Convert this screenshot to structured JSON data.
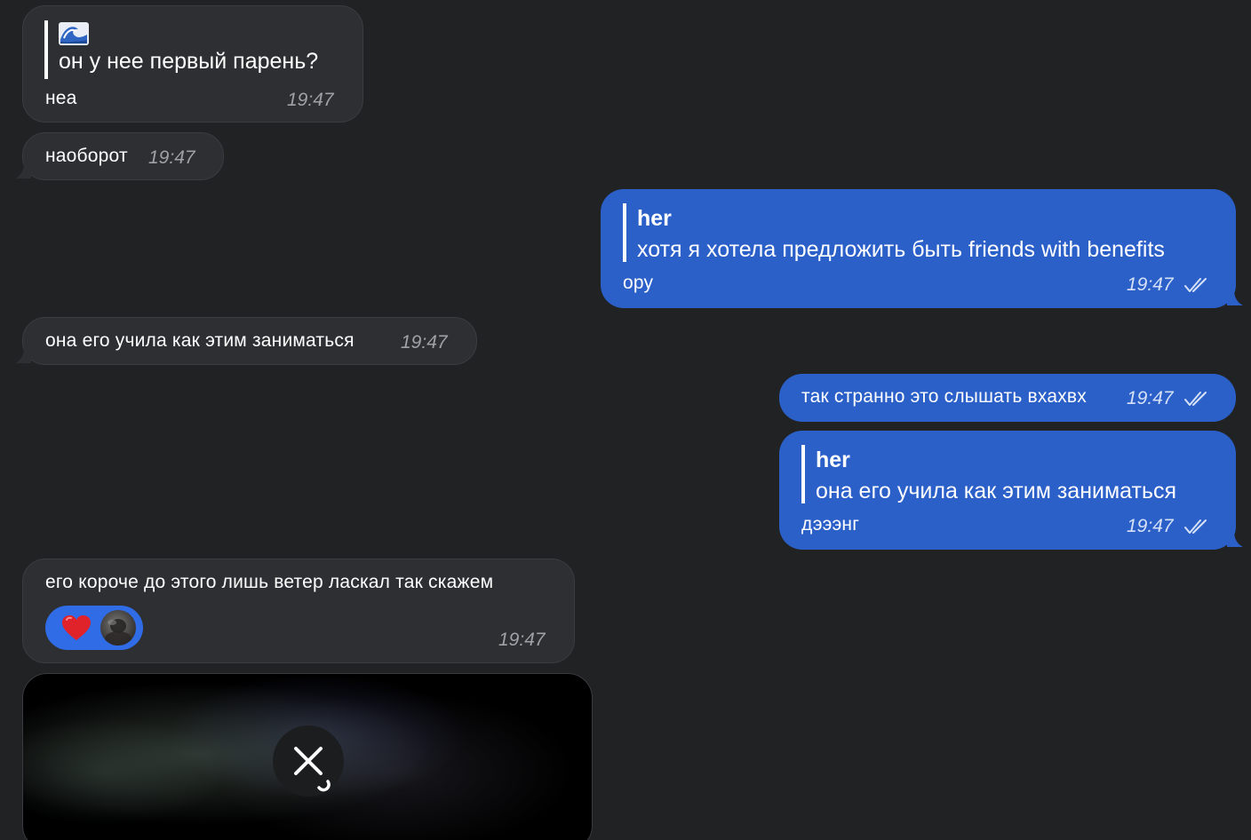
{
  "messages": {
    "m1": {
      "quote_title_icon": "water-wave-emoji",
      "quote_text": "он у нее первый парень?",
      "text": "неа",
      "time": "19:47"
    },
    "m2": {
      "text": "наоборот",
      "time": "19:47"
    },
    "m3": {
      "quote_title": "her",
      "quote_text": "хотя я хотела предложить быть friends with benefits",
      "text": "ору",
      "time": "19:47",
      "status_icon": "double-check-icon"
    },
    "m4": {
      "text": "она его учила как этим заниматься",
      "time": "19:47"
    },
    "m5": {
      "text": "так странно это слышать вхахвх",
      "time": "19:47",
      "status_icon": "double-check-icon"
    },
    "m6": {
      "quote_title": "her",
      "quote_text": "она его учила как этим заниматься",
      "text": "дэээнг",
      "time": "19:47",
      "status_icon": "double-check-icon"
    },
    "m7": {
      "text": "его короче до этого лишь ветер ласкал так скажем",
      "time": "19:47",
      "reaction": {
        "emoji": "red-heart",
        "icon": "heart-icon"
      }
    },
    "m8": {
      "type": "media",
      "icon": "close-icon"
    }
  },
  "colors": {
    "background": "#212224",
    "incoming_bubble": "#2e2f32",
    "outgoing_bubble": "#2b60c9",
    "reaction_pill": "#2f6ce6",
    "timestamp_incoming": "#9ea2a8",
    "timestamp_outgoing": "#d6e1f7"
  }
}
